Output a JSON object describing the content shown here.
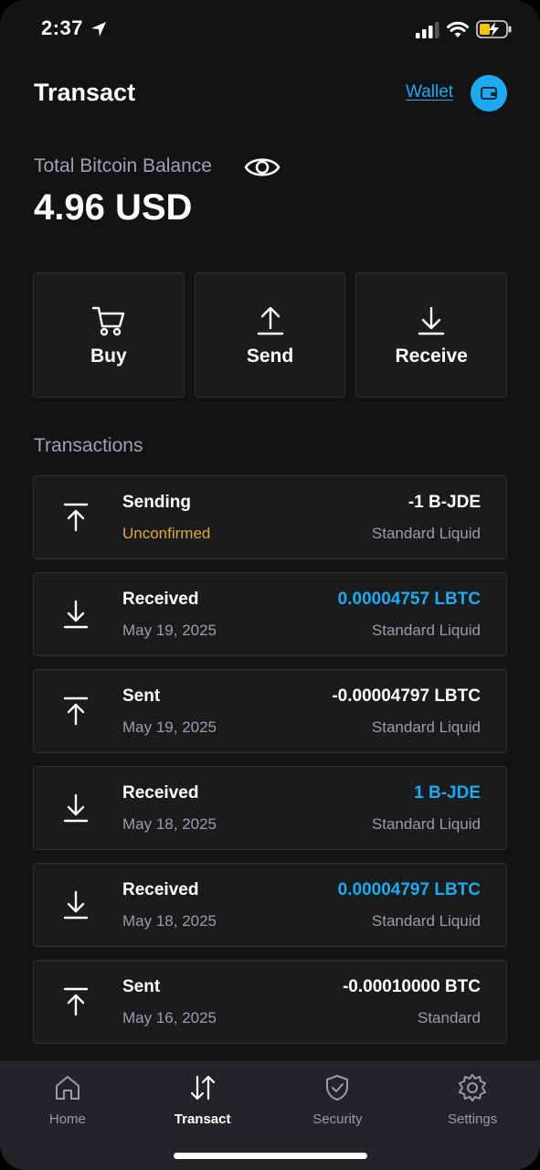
{
  "status_bar": {
    "time": "2:37",
    "icons": [
      "location-arrow-icon",
      "signal-icon",
      "wifi-icon",
      "battery-charging-icon"
    ]
  },
  "header": {
    "title": "Transact",
    "wallet_link": "Wallet",
    "wallet_icon": "wallet-icon"
  },
  "balance": {
    "label": "Total Bitcoin Balance",
    "value": "4.96 USD",
    "visibility_icon": "eye-icon"
  },
  "actions": [
    {
      "label": "Buy",
      "icon": "cart-icon"
    },
    {
      "label": "Send",
      "icon": "upload-arrow-icon"
    },
    {
      "label": "Receive",
      "icon": "download-arrow-icon"
    }
  ],
  "transactions": {
    "title": "Transactions",
    "items": [
      {
        "direction": "send",
        "type": "Sending",
        "date": "Unconfirmed",
        "amount": "-1 B-JDE",
        "network": "Standard Liquid",
        "pending": true,
        "positive": false
      },
      {
        "direction": "receive",
        "type": "Received",
        "date": "May 19, 2025",
        "amount": "0.00004757 LBTC",
        "network": "Standard Liquid",
        "pending": false,
        "positive": true
      },
      {
        "direction": "send",
        "type": "Sent",
        "date": "May 19, 2025",
        "amount": "-0.00004797 LBTC",
        "network": "Standard Liquid",
        "pending": false,
        "positive": false
      },
      {
        "direction": "receive",
        "type": "Received",
        "date": "May 18, 2025",
        "amount": "1 B-JDE",
        "network": "Standard Liquid",
        "pending": false,
        "positive": true
      },
      {
        "direction": "receive",
        "type": "Received",
        "date": "May 18, 2025",
        "amount": "0.00004797 LBTC",
        "network": "Standard Liquid",
        "pending": false,
        "positive": true
      },
      {
        "direction": "send",
        "type": "Sent",
        "date": "May 16, 2025",
        "amount": "-0.00010000 BTC",
        "network": "Standard",
        "pending": false,
        "positive": false
      }
    ]
  },
  "tabs": [
    {
      "label": "Home",
      "icon": "home-icon",
      "active": false
    },
    {
      "label": "Transact",
      "icon": "transfer-arrows-icon",
      "active": true
    },
    {
      "label": "Security",
      "icon": "shield-check-icon",
      "active": false
    },
    {
      "label": "Settings",
      "icon": "gear-icon",
      "active": false
    }
  ],
  "colors": {
    "background": "#121314",
    "card": "#1a1b1d",
    "accent": "#1eaaf1",
    "pending": "#e0a73a",
    "muted_text": "#9a9da2"
  }
}
